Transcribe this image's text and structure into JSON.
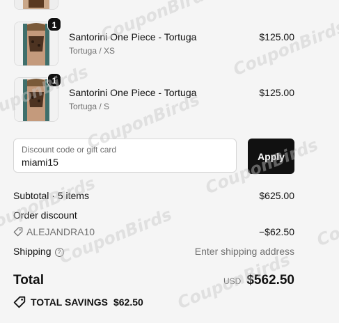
{
  "cart": {
    "items": [
      {
        "title": "Santorini One Piece - Tortuga",
        "variant": "Tortuga / XS",
        "price": "$125.00",
        "quantity": "1",
        "image": "swimsuit-model-photo"
      },
      {
        "title": "Santorini One Piece - Tortuga",
        "variant": "Tortuga / S",
        "price": "$125.00",
        "quantity": "1",
        "image": "swimsuit-model-photo"
      }
    ]
  },
  "discount": {
    "label": "Discount code or gift card",
    "value": "miami15",
    "apply_label": "Apply"
  },
  "summary": {
    "subtotal_label": "Subtotal · 5 items",
    "subtotal_value": "$625.00",
    "order_discount_label": "Order discount",
    "discount_code": "ALEJANDRA10",
    "discount_value": "−$62.50",
    "shipping_label": "Shipping",
    "shipping_value": "Enter shipping address",
    "total_label": "Total",
    "currency": "USD",
    "total_value": "$562.50",
    "savings_label": "TOTAL SAVINGS",
    "savings_value": "$62.50"
  },
  "watermark": "CouponBirds",
  "colors": {
    "button": "#111111",
    "muted": "#707070",
    "background": "#f5f5f5"
  },
  "icons": {
    "discount_tag": "tag-icon",
    "shipping_help": "question-circle-icon",
    "savings": "tag-icon"
  }
}
